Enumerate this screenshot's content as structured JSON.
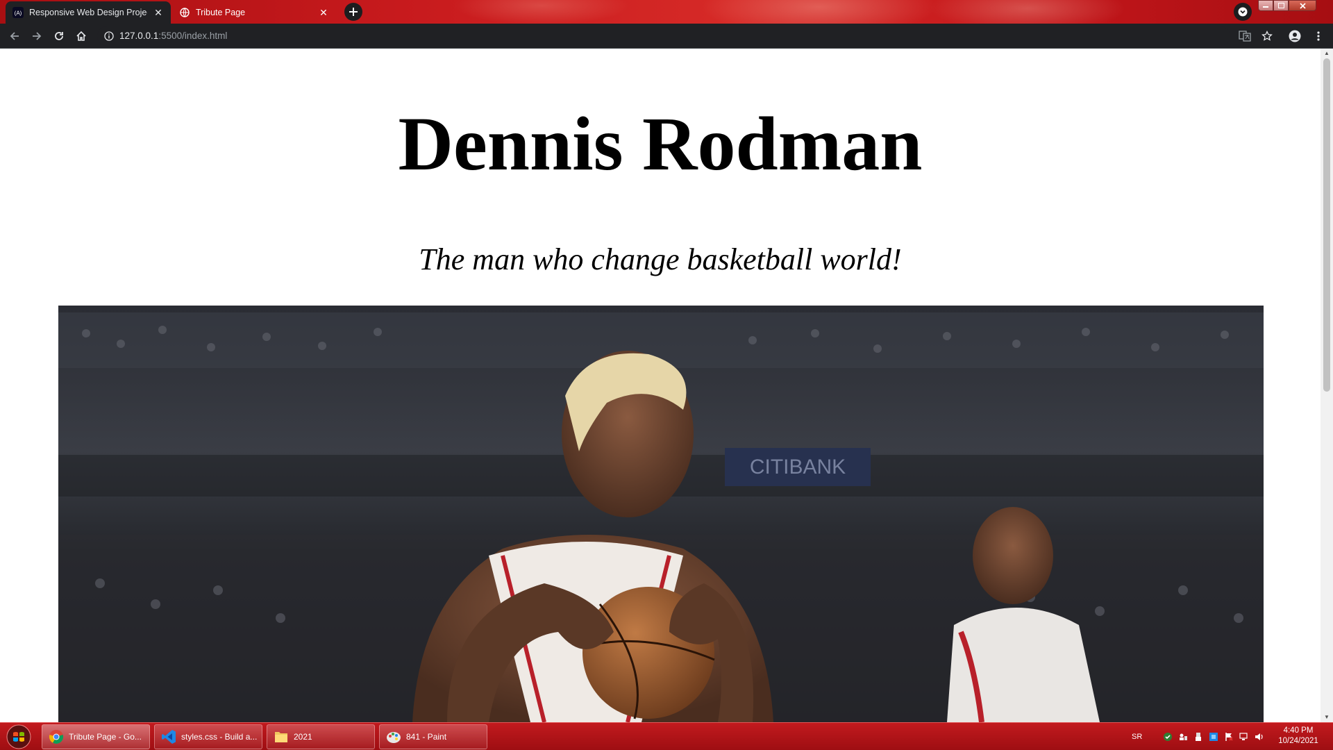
{
  "browser": {
    "tabs": [
      {
        "title": "Responsive Web Design Projects",
        "favicon": "freecodecamp-icon",
        "active": true
      },
      {
        "title": "Tribute Page",
        "favicon": "globe-icon",
        "active": false
      }
    ],
    "close_glyph": "✕",
    "new_tab_glyph": "+",
    "address": {
      "host": "127.0.0.1",
      "path": ":5500/index.html"
    }
  },
  "page": {
    "title": "Dennis Rodman",
    "subtitle": "The man who change basketball world!",
    "image": "basketball-player-photo"
  },
  "taskbar": {
    "items": [
      {
        "label": "Tribute Page - Go...",
        "icon": "chrome-icon",
        "active": true
      },
      {
        "label": "styles.css - Build a...",
        "icon": "vscode-icon",
        "active": false
      },
      {
        "label": "2021",
        "icon": "folder-icon",
        "active": false
      },
      {
        "label": "841 - Paint",
        "icon": "paint-icon",
        "active": false
      }
    ],
    "tray": {
      "language": "SR"
    },
    "clock": {
      "time": "4:40 PM",
      "date": "10/24/2021"
    }
  },
  "colors": {
    "tab_strip": "#c71a1d",
    "toolbar": "#202124",
    "taskbar": "#b3141a"
  }
}
